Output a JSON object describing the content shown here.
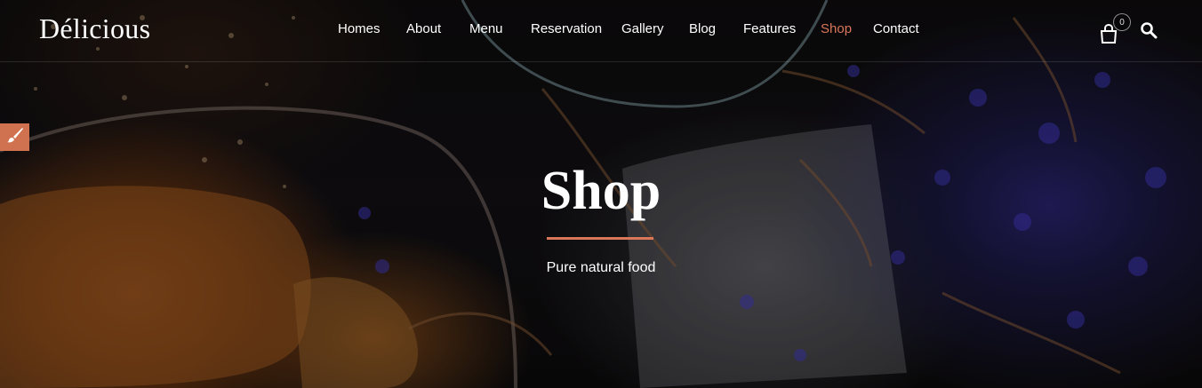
{
  "brand": {
    "logo_text": "Délicious"
  },
  "nav": {
    "items": [
      {
        "label": "Homes"
      },
      {
        "label": "About"
      },
      {
        "label": "Menu"
      },
      {
        "label": "Reservation"
      },
      {
        "label": "Gallery"
      },
      {
        "label": "Blog"
      },
      {
        "label": "Features"
      },
      {
        "label": "Shop"
      },
      {
        "label": "Contact"
      }
    ],
    "active": "Shop"
  },
  "cart": {
    "count": "0",
    "icon": "shopping-bag-icon"
  },
  "search": {
    "icon": "search-icon"
  },
  "customizer": {
    "icon": "paintbrush-icon"
  },
  "hero": {
    "title": "Shop",
    "subtitle": "Pure natural food"
  },
  "colors": {
    "accent": "#d8775a",
    "customizer_bg": "#d0714f",
    "text": "#ffffff"
  }
}
